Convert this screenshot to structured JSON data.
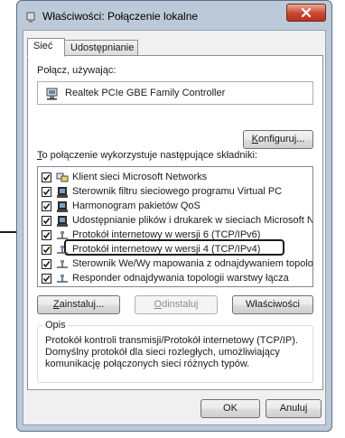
{
  "window": {
    "title": "Właściwości: Połączenie lokalne"
  },
  "tabs": [
    {
      "label": "Sieć"
    },
    {
      "label": "Udostępnianie"
    }
  ],
  "connect_label": "Połącz, używając:",
  "adapter_name": "Realtek PCIe GBE Family Controller",
  "configure": {
    "u": "K",
    "rest": "onfiguruj..."
  },
  "components_label": {
    "u": "T",
    "rest": "o połączenie wykorzystuje następujące składniki:"
  },
  "components": [
    {
      "label": "Klient sieci Microsoft Networks",
      "checked": true,
      "icon": "network-client-icon"
    },
    {
      "label": "Sterownik filtru sieciowego programu Virtual PC",
      "checked": true,
      "icon": "network-service-icon"
    },
    {
      "label": "Harmonogram pakietów QoS",
      "checked": true,
      "icon": "network-service-icon"
    },
    {
      "label": "Udostępnianie plików i drukarek w sieciach Microsoft N...",
      "checked": true,
      "icon": "network-service-icon"
    },
    {
      "label": "Protokół internetowy w wersji 6 (TCP/IPv6)",
      "checked": true,
      "icon": "protocol-icon"
    },
    {
      "label": "Protokół internetowy w wersji 4 (TCP/IPv4)",
      "checked": true,
      "icon": "protocol-icon"
    },
    {
      "label": "Sterownik We/Wy mapowania z odnajdywaniem topolo...",
      "checked": true,
      "icon": "protocol-icon"
    },
    {
      "label": "Responder odnajdywania topologii warstwy łącza",
      "checked": true,
      "icon": "protocol-icon"
    }
  ],
  "buttons": {
    "install": {
      "u": "Z",
      "rest": "ainstaluj..."
    },
    "uninstall": {
      "u": "O",
      "rest": "dinstaluj"
    },
    "properties": "Właściwości",
    "ok": "OK",
    "cancel": "Anuluj"
  },
  "description": {
    "legend": "Opis",
    "text": "Protokół kontroli transmisji/Protokół internetowy (TCP/IP).\nDomyślny protokół dla sieci rozległych, umożliwiający\nkomunikację połączonych sieci różnych typów."
  },
  "colors": {
    "frame": "#bcc9d8",
    "close_button": "#c9472f",
    "highlight_border": "#1a1a1a"
  }
}
